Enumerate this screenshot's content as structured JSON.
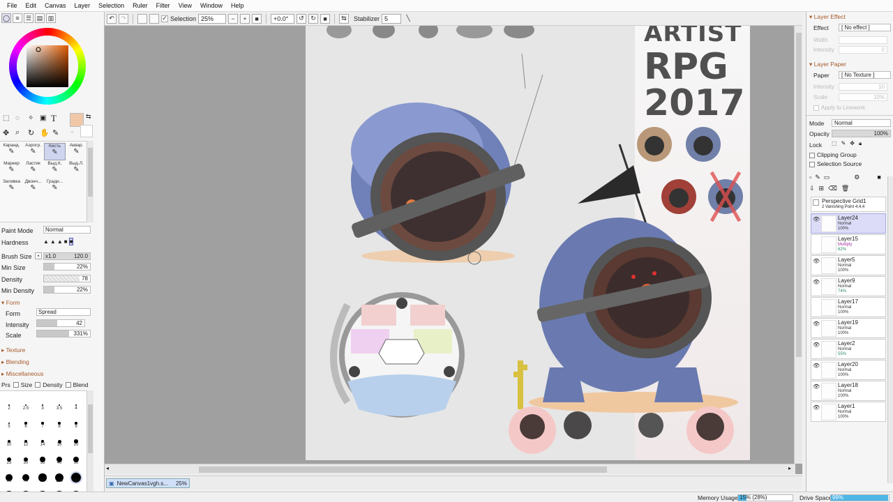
{
  "menu": [
    "File",
    "Edit",
    "Canvas",
    "Layer",
    "Selection",
    "Ruler",
    "Filter",
    "View",
    "Window",
    "Help"
  ],
  "toolbar": {
    "selection_label": "Selection",
    "zoom_value": "25%",
    "rotation_value": "+0.0°",
    "stabilizer_label": "Stabilizer",
    "stabilizer_value": "5"
  },
  "tools": {
    "brushes": [
      {
        "label": "Каранд."
      },
      {
        "label": "Аэрогр."
      },
      {
        "label": "Кисть"
      },
      {
        "label": "Аквар."
      },
      {
        "label": "Маркер"
      },
      {
        "label": "Ластик"
      },
      {
        "label": "Выд.К."
      },
      {
        "label": "Выд.Л."
      },
      {
        "label": "Заливка"
      },
      {
        "label": "Двоич..."
      },
      {
        "label": "Гради..."
      }
    ],
    "selected_brush": "Кисть"
  },
  "brush_settings": {
    "paint_mode_label": "Paint Mode",
    "paint_mode_value": "Normal",
    "hardness_label": "Hardness",
    "brush_size_label": "Brush Size",
    "brush_size_mult": "x1.0",
    "brush_size_value": "120.0",
    "min_size_label": "Min Size",
    "min_size_value": "22%",
    "density_label": "Density",
    "density_value": "78",
    "min_density_label": "Min Density",
    "min_density_value": "22%",
    "form_section": "Form",
    "form_label": "Form",
    "form_value": "Spread",
    "intensity_label": "Intensity",
    "intensity_value": "42",
    "scale_label": "Scale",
    "scale_value": "331%",
    "texture_section": "Texture",
    "blending_section": "Blending",
    "misc_section": "Miscellaneous",
    "prs_label": "Prs",
    "size_chk": "Size",
    "density_chk": "Density",
    "blend_chk": "Blend"
  },
  "size_presets": [
    "2",
    "2.5",
    "3",
    "3.5",
    "4",
    "5",
    "6",
    "7",
    "8",
    "9",
    "10",
    "12",
    "14",
    "16",
    "20",
    "25",
    "30",
    "35",
    "40",
    "50",
    "60",
    "70",
    "80",
    "100",
    "120",
    "160",
    "200",
    "250",
    "300",
    "350"
  ],
  "right_panel": {
    "layer_effect_title": "Layer Effect",
    "effect_label": "Effect",
    "effect_value": "[ No effect ]",
    "width_label": "Width",
    "intensity_label": "Intensity",
    "intensity_value": "0",
    "layer_paper_title": "Layer Paper",
    "paper_label": "Paper",
    "paper_value": "[ No Texture ]",
    "paper_intensity_value": "10",
    "scale_label": "Scale",
    "scale_value": "10%",
    "apply_linework": "Apply to Linework",
    "mode_label": "Mode",
    "mode_value": "Normal",
    "opacity_label": "Opacity",
    "opacity_value": "100%",
    "lock_label": "Lock",
    "clipping_group": "Clipping Group",
    "selection_source": "Selection Source"
  },
  "perspective": {
    "name": "Perspective Grid1",
    "detail": "2 Vanishing Point 4,4,4"
  },
  "layers": [
    {
      "name": "Layer24",
      "mode": "Normal",
      "opacity": "100%"
    },
    {
      "name": "Layer15",
      "mode": "Multiply",
      "opacity": "62%"
    },
    {
      "name": "Layer5",
      "mode": "Normal",
      "opacity": "100%"
    },
    {
      "name": "Layer9",
      "mode": "Normal",
      "opacity": "74%"
    },
    {
      "name": "Layer17",
      "mode": "Normal",
      "opacity": "100%"
    },
    {
      "name": "Layer19",
      "mode": "Normal",
      "opacity": "100%"
    },
    {
      "name": "Layer2",
      "mode": "Normal",
      "opacity": "55%"
    },
    {
      "name": "Layer20",
      "mode": "Normal",
      "opacity": "100%"
    },
    {
      "name": "Layer18",
      "mode": "Normal",
      "opacity": "100%"
    },
    {
      "name": "Layer1",
      "mode": "Normal",
      "opacity": "100%"
    }
  ],
  "canvas_art": {
    "title_line1": "ARTIST",
    "title_line2": "RPG",
    "title_line3": "2017"
  },
  "document_tab": {
    "name": "NewCanvas1vgh.s...",
    "zoom": "25%"
  },
  "status": {
    "memory_label": "Memory Usage",
    "memory_value": "15% (28%)",
    "memory_fraction": 0.15,
    "drive_label": "Drive Space",
    "drive_value": "99%",
    "drive_fraction": 0.99
  },
  "colors": {
    "accent_orange": "#a55a2a",
    "selected_layer": "#dcdcf8",
    "primary_color": "#f0c8a8",
    "status_bar_fill": "#4fb6e8"
  }
}
